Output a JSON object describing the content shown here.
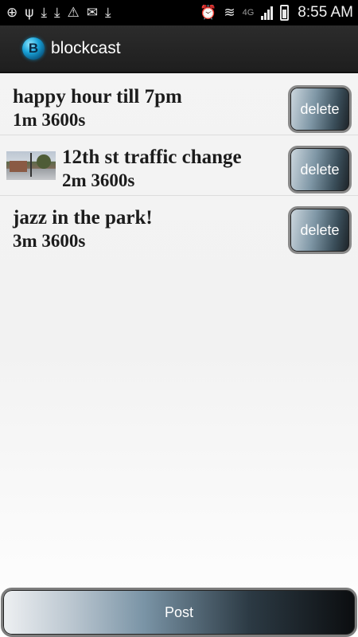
{
  "status_bar": {
    "left_icons": [
      "add-icon",
      "usb-icon",
      "download-icon",
      "download-icon",
      "warning-icon",
      "mail-icon",
      "download-icon"
    ],
    "network_label": "4G",
    "time": "8:55 AM"
  },
  "action_bar": {
    "logo_letter": "B",
    "title": "blockcast"
  },
  "items": [
    {
      "title": "happy hour till 7pm",
      "meta": "1m 3600s",
      "has_thumbnail": false,
      "delete_label": "delete"
    },
    {
      "title": "12th st traffic change",
      "meta": "2m 3600s",
      "has_thumbnail": true,
      "delete_label": "delete"
    },
    {
      "title": "jazz in the park!",
      "meta": "3m 3600s",
      "has_thumbnail": false,
      "delete_label": "delete"
    }
  ],
  "post_button": {
    "label": "Post"
  }
}
